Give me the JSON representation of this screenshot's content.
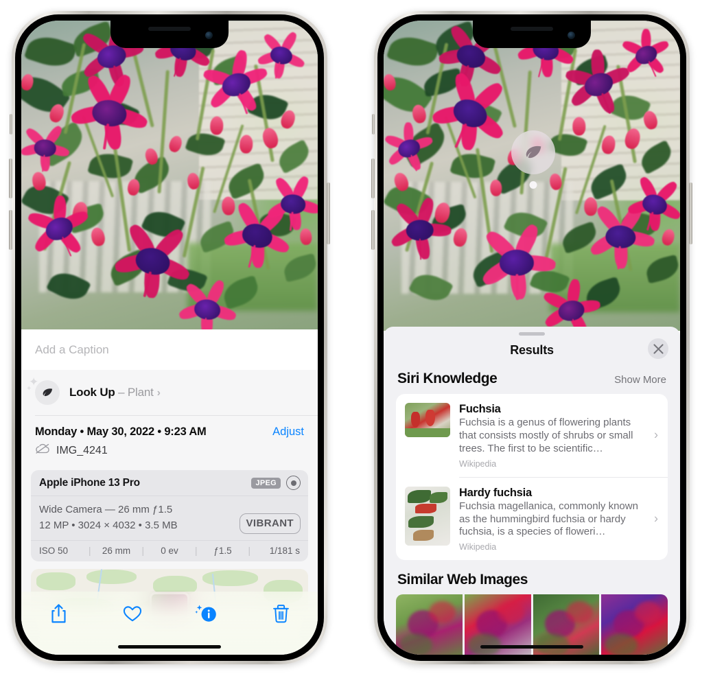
{
  "left_phone": {
    "caption": {
      "placeholder": "Add a Caption",
      "value": ""
    },
    "lookup": {
      "icon": "leaf-icon",
      "label": "Look Up",
      "dash": " – ",
      "subject": "Plant",
      "chevron": "›"
    },
    "meta": {
      "date": "Monday • May 30, 2022 • 9:23 AM",
      "adjust_label": "Adjust",
      "cloud_icon": "icloud-slash-icon",
      "filename": "IMG_4241"
    },
    "exif": {
      "model": "Apple iPhone 13 Pro",
      "format_badge": "JPEG",
      "aperture_icon": "aperture-icon",
      "lens_line": "Wide Camera — 26 mm ƒ1.5",
      "size_line": "12 MP • 3024 × 4032 • 3.5 MB",
      "style_badge": "VIBRANT",
      "stats": [
        "ISO 50",
        "26 mm",
        "0 ev",
        "ƒ1.5",
        "1/181 s"
      ]
    },
    "toolbar": [
      {
        "name": "share-button",
        "icon": "share-icon"
      },
      {
        "name": "favorite-button",
        "icon": "heart-icon"
      },
      {
        "name": "info-button",
        "icon": "info-sparkle-icon"
      },
      {
        "name": "delete-button",
        "icon": "trash-icon"
      }
    ]
  },
  "right_phone": {
    "pin": {
      "icon": "leaf-icon"
    },
    "header": {
      "title": "Results",
      "close_icon": "close-icon"
    },
    "siri_knowledge": {
      "title": "Siri Knowledge",
      "show_more": "Show More",
      "items": [
        {
          "title": "Fuchsia",
          "description": "Fuchsia is a genus of flowering plants that consists mostly of shrubs or small trees. The first to be scientific…",
          "source": "Wikipedia",
          "chevron": "›"
        },
        {
          "title": "Hardy fuchsia",
          "description": "Fuchsia magellanica, commonly known as the hummingbird fuchsia or hardy fuchsia, is a species of floweri…",
          "source": "Wikipedia",
          "chevron": "›"
        }
      ]
    },
    "similar_web_images": {
      "title": "Similar Web Images",
      "count": 4
    }
  },
  "colors": {
    "accent_blue": "#0a84ff",
    "sheet_bg": "#f6f6f7",
    "results_bg": "#f1f1f4",
    "card_bg": "#ffffff",
    "badge_gray": "#9a9aa0"
  }
}
